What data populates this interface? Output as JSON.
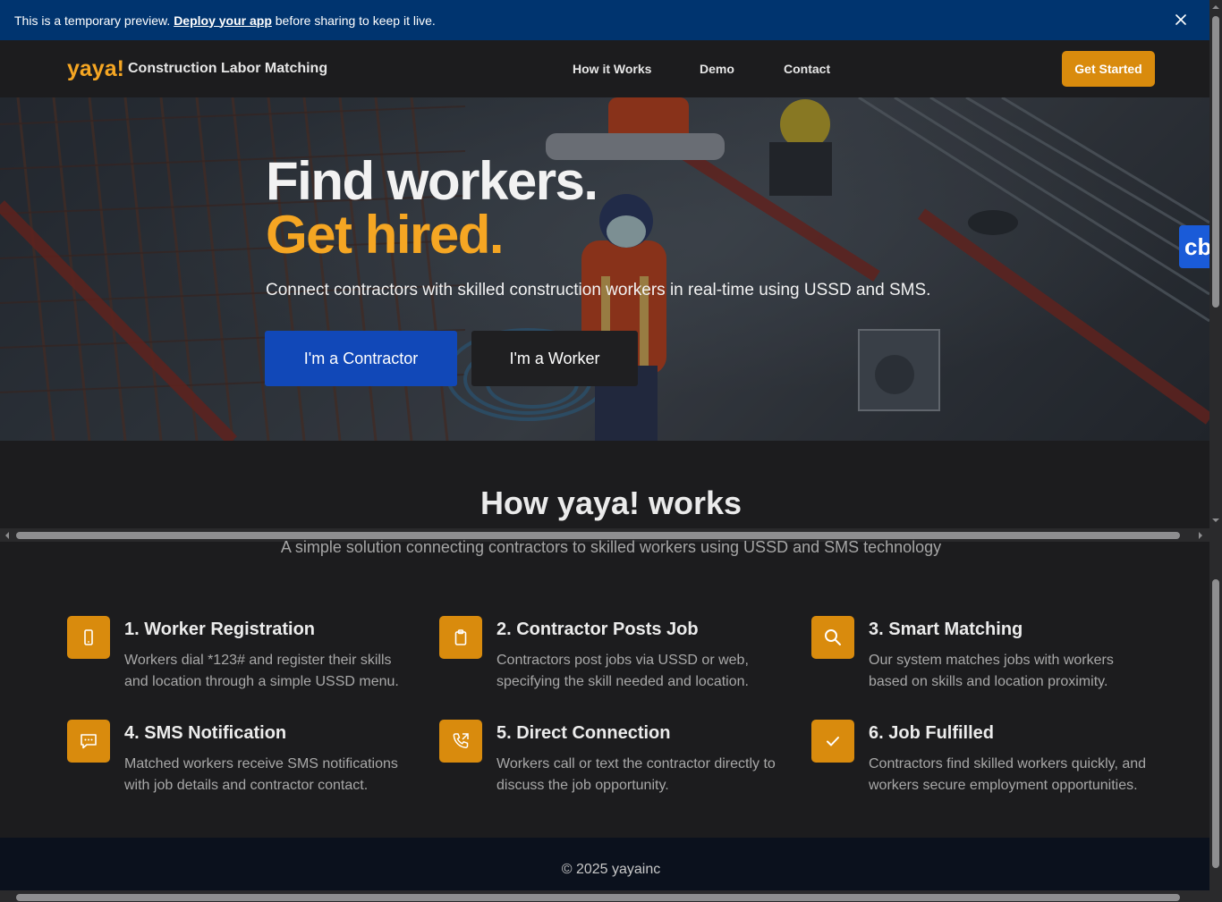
{
  "banner": {
    "prefix": "This is a temporary preview.",
    "link": "Deploy your app",
    "suffix": "before sharing to keep it live."
  },
  "nav": {
    "logo": "yaya!",
    "subtitle": "Construction Labor Matching",
    "links": [
      "How it Works",
      "Demo",
      "Contact"
    ],
    "cta": "Get Started"
  },
  "hero": {
    "title_line1": "Find workers.",
    "title_line2": "Get hired.",
    "subtitle": "Connect contractors with skilled construction workers in real-time using USSD and SMS.",
    "contractor_button": "I'm a Contractor",
    "worker_button": "I'm a Worker",
    "widget_label": "cb"
  },
  "how": {
    "title": "How yaya! works",
    "subtitle": "A simple solution connecting contractors to skilled workers using USSD and SMS technology",
    "steps": [
      {
        "icon": "phone-icon",
        "title": "1. Worker Registration",
        "desc": "Workers dial *123# and register their skills and location through a simple USSD menu."
      },
      {
        "icon": "clipboard-icon",
        "title": "2. Contractor Posts Job",
        "desc": "Contractors post jobs via USSD or web, specifying the skill needed and location."
      },
      {
        "icon": "search-icon",
        "title": "3. Smart Matching",
        "desc": "Our system matches jobs with workers based on skills and location proximity."
      },
      {
        "icon": "message-icon",
        "title": "4. SMS Notification",
        "desc": "Matched workers receive SMS notifications with job details and contractor contact."
      },
      {
        "icon": "phone-call-icon",
        "title": "5. Direct Connection",
        "desc": "Workers call or text the contractor directly to discuss the job opportunity."
      },
      {
        "icon": "check-icon",
        "title": "6. Job Fulfilled",
        "desc": "Contractors find skilled workers quickly, and workers secure employment opportunities."
      }
    ]
  },
  "footer": {
    "text": "© 2025 yayainc"
  },
  "colors": {
    "accent": "#f5a623",
    "button_orange": "#d98b0d",
    "primary_blue": "#1148b8",
    "banner_blue": "#00346f",
    "background": "#1c1c1e",
    "footer": "#0b111d"
  }
}
